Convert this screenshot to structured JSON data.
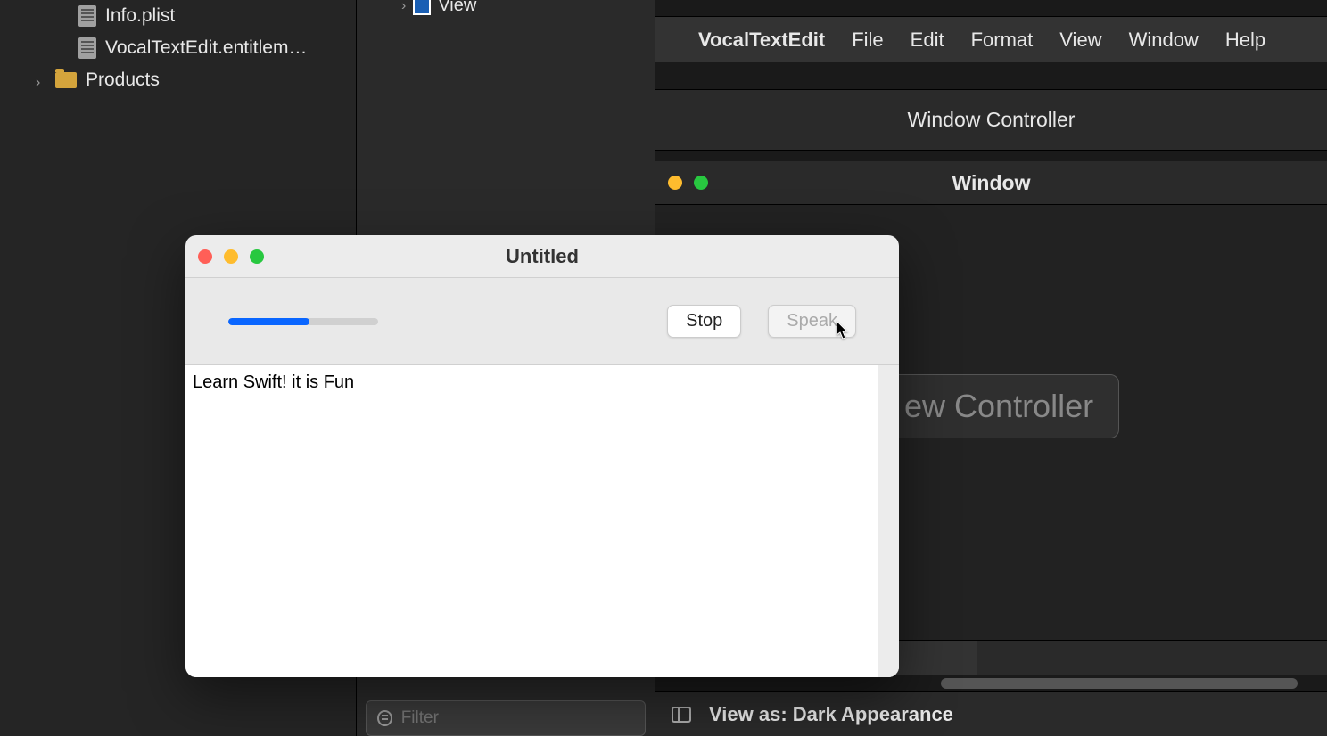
{
  "sidebar": {
    "items": [
      {
        "label": "Info.plist"
      },
      {
        "label": "VocalTextEdit.entitlem…"
      },
      {
        "label": "Products"
      }
    ]
  },
  "outline": {
    "view_label": "View",
    "filter_placeholder": "Filter"
  },
  "ib": {
    "menu": {
      "app": "VocalTextEdit",
      "items": [
        "File",
        "Edit",
        "Format",
        "View",
        "Window",
        "Help"
      ]
    },
    "window_controller_label": "Window Controller",
    "window_title": "Window",
    "view_controller_label": "ew Controller",
    "bottom": {
      "view_as": "View as: Dark Appearance"
    }
  },
  "app_window": {
    "title": "Untitled",
    "progress_percent": 54,
    "stop_label": "Stop",
    "speak_label": "Speak",
    "text_content": "Learn Swift! it is Fun"
  }
}
